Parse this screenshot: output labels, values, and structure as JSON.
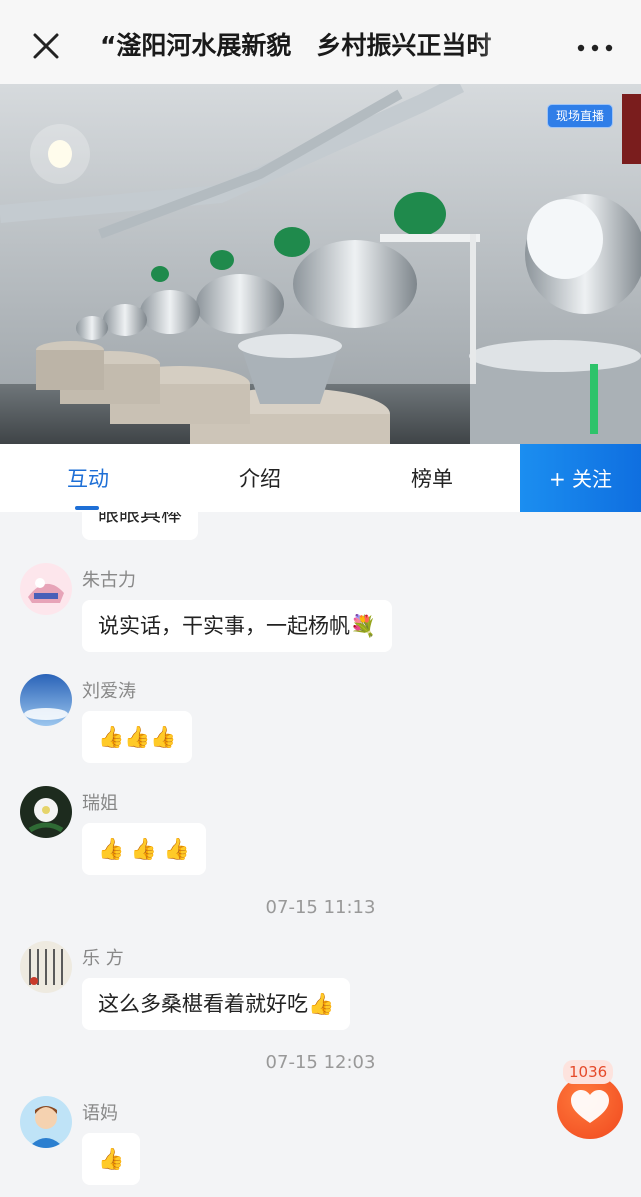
{
  "header": {
    "title": "“滏阳河水展新貌　乡村振兴正当时",
    "close_icon": "close-icon",
    "more_icon": "more-dots-icon"
  },
  "video": {
    "badge": "现场直播"
  },
  "tabs": [
    {
      "label": "互动",
      "active": true
    },
    {
      "label": "介绍",
      "active": false
    },
    {
      "label": "榜单",
      "active": false
    }
  ],
  "follow": {
    "label": "+ 关注"
  },
  "chat": {
    "partial_message": "眼眼具棒",
    "messages": [
      {
        "name": "朱古力",
        "text": "说实话，干实事，一起杨帆💐"
      },
      {
        "name": "刘爱涛",
        "text": "👍👍👍"
      },
      {
        "name": "瑞姐",
        "text": "👍 👍 👍"
      },
      {
        "name": "乐 方",
        "text": "这么多桑椹看着就好吃👍"
      },
      {
        "name": "语妈",
        "text": "👍"
      }
    ],
    "timestamps": [
      "07-15 11:13",
      "07-15 12:03"
    ]
  },
  "like": {
    "count": "1036",
    "icon": "heart-icon"
  },
  "colors": {
    "accent": "#1e6fd6",
    "like": "#f0481e"
  }
}
